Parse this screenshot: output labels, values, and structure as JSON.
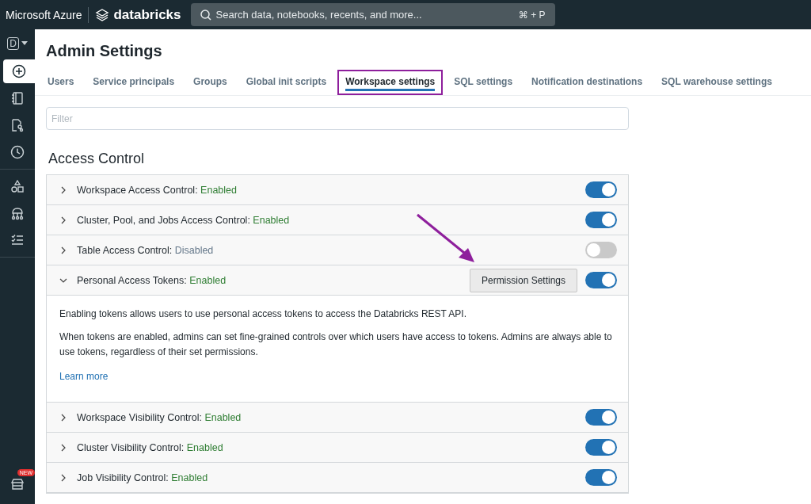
{
  "topbar": {
    "brand": "Microsoft Azure",
    "product": "databricks",
    "search": {
      "placeholder": "Search data, notebooks, recents, and more...",
      "shortcut": "⌘ + P"
    }
  },
  "sidebar": {
    "workspace": "D",
    "items": [
      {
        "kind": "new",
        "selected": true
      },
      {
        "kind": "notebook",
        "selected": false
      },
      {
        "kind": "workflow",
        "selected": false
      },
      {
        "kind": "recents",
        "selected": false
      },
      {
        "kind": "shapes",
        "selected": false
      },
      {
        "kind": "hierarchy",
        "selected": false
      },
      {
        "kind": "checklist",
        "selected": false
      }
    ],
    "marketplace": {
      "badge": "NEW"
    }
  },
  "page": {
    "title": "Admin Settings"
  },
  "tabs": [
    {
      "label": "Users",
      "selected": false,
      "highlighted": false
    },
    {
      "label": "Service principals",
      "selected": false,
      "highlighted": false
    },
    {
      "label": "Groups",
      "selected": false,
      "highlighted": false
    },
    {
      "label": "Global init scripts",
      "selected": false,
      "highlighted": false
    },
    {
      "label": "Workspace settings",
      "selected": true,
      "highlighted": true
    },
    {
      "label": "SQL settings",
      "selected": false,
      "highlighted": false
    },
    {
      "label": "Notification destinations",
      "selected": false,
      "highlighted": false
    },
    {
      "label": "SQL warehouse settings",
      "selected": false,
      "highlighted": false
    }
  ],
  "filter": {
    "placeholder": "Filter"
  },
  "section": {
    "title": "Access Control",
    "settings": [
      {
        "label": "Workspace Access Control:",
        "status": "Enabled",
        "on": true,
        "expanded": false
      },
      {
        "label": "Cluster, Pool, and Jobs Access Control:",
        "status": "Enabled",
        "on": true,
        "expanded": false
      },
      {
        "label": "Table Access Control:",
        "status": "Disabled",
        "on": false,
        "expanded": false
      },
      {
        "label": "Personal Access Tokens:",
        "status": "Enabled",
        "on": true,
        "expanded": true,
        "button": "Permission Settings",
        "description": [
          "Enabling tokens allows users to use personal access tokens to access the Databricks REST API.",
          "When tokens are enabled, admins can set fine-grained controls over which users have access to tokens. Admins are always able to use tokens, regardless of their set permissions."
        ],
        "link": "Learn more"
      },
      {
        "label": "Workspace Visibility Control:",
        "status": "Enabled",
        "on": true,
        "expanded": false
      },
      {
        "label": "Cluster Visibility Control:",
        "status": "Enabled",
        "on": true,
        "expanded": false
      },
      {
        "label": "Job Visibility Control:",
        "status": "Enabled",
        "on": true,
        "expanded": false
      }
    ]
  }
}
